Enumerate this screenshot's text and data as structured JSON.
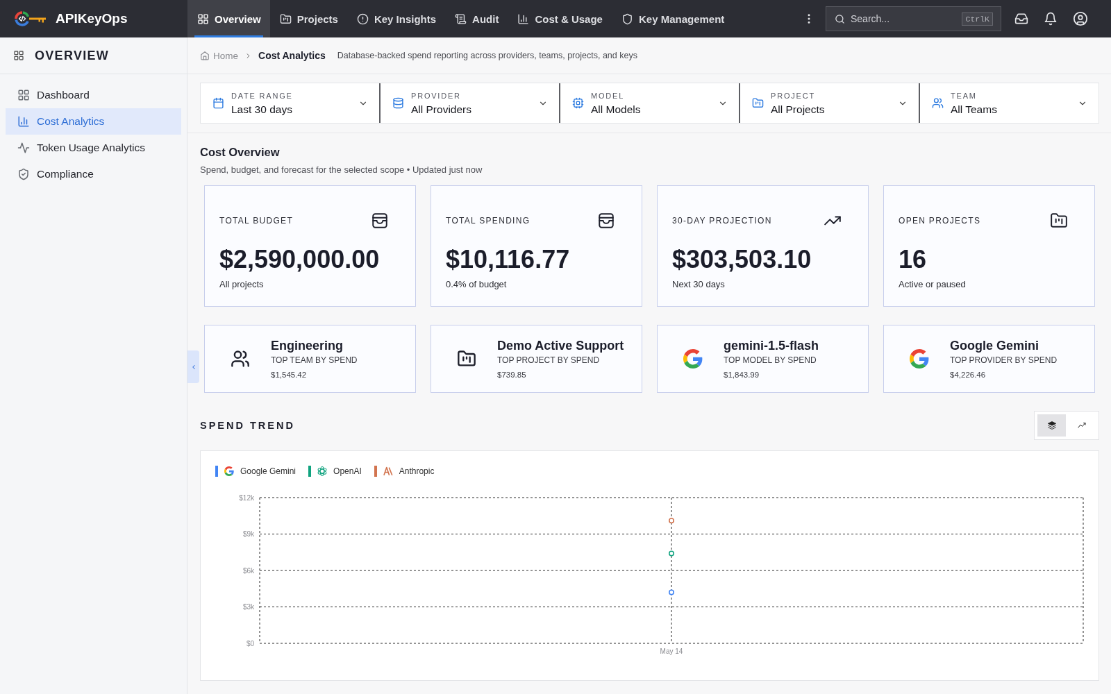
{
  "app": {
    "name": "APIKeyOps"
  },
  "nav": {
    "tabs": [
      {
        "label": "Overview",
        "kind": "overview",
        "selected": true
      },
      {
        "label": "Projects",
        "kind": "projects",
        "selected": false
      },
      {
        "label": "Key Insights",
        "kind": "insights",
        "selected": false
      },
      {
        "label": "Audit",
        "kind": "audit",
        "selected": false
      },
      {
        "label": "Cost & Usage",
        "kind": "cost",
        "selected": false
      },
      {
        "label": "Key Management",
        "kind": "keys",
        "selected": false
      }
    ],
    "search": {
      "placeholder": "Search...",
      "shortcut": "CtrlK"
    }
  },
  "sidebar": {
    "title": "OVERVIEW",
    "items": [
      {
        "label": "Dashboard",
        "kind": "dashboard",
        "selected": false
      },
      {
        "label": "Cost Analytics",
        "kind": "cost",
        "selected": true
      },
      {
        "label": "Token Usage Analytics",
        "kind": "tokens",
        "selected": false
      },
      {
        "label": "Compliance",
        "kind": "compliance",
        "selected": false
      }
    ]
  },
  "breadcrumb": {
    "items": [
      {
        "label": "Home",
        "current": false
      },
      {
        "label": "Cost Analytics",
        "current": true
      }
    ],
    "description": "Database-backed spend reporting across providers, teams, projects, and keys"
  },
  "filters": [
    {
      "kind": "date",
      "label": "DATE RANGE",
      "value": "Last 30 days"
    },
    {
      "kind": "provider",
      "label": "PROVIDER",
      "value": "All Providers"
    },
    {
      "kind": "model",
      "label": "MODEL",
      "value": "All Models"
    },
    {
      "kind": "project",
      "label": "PROJECT",
      "value": "All Projects"
    },
    {
      "kind": "team",
      "label": "TEAM",
      "value": "All Teams"
    }
  ],
  "cost_overview": {
    "title": "Cost Overview",
    "subtitle": "Spend, budget, and forecast for the selected scope • Updated just now",
    "stat_cards": [
      {
        "kind": "budget",
        "label": "TOTAL BUDGET",
        "value": "$2,590,000.00",
        "note": "All projects"
      },
      {
        "kind": "spending",
        "label": "TOTAL SPENDING",
        "value": "$10,116.77",
        "note": "0.4% of budget"
      },
      {
        "kind": "projection",
        "label": "30-DAY PROJECTION",
        "value": "$303,503.10",
        "note": "Next 30 days"
      },
      {
        "kind": "projects",
        "label": "OPEN PROJECTS",
        "value": "16",
        "note": "Active or paused"
      }
    ],
    "top_cards": [
      {
        "kind": "team",
        "title": "Engineering",
        "label": "TOP TEAM BY SPEND",
        "amount": "$1,545.42"
      },
      {
        "kind": "project",
        "title": "Demo Active Support",
        "label": "TOP PROJECT BY SPEND",
        "amount": "$739.85"
      },
      {
        "kind": "google",
        "title": "gemini-1.5-flash",
        "label": "TOP MODEL BY SPEND",
        "amount": "$1,843.99"
      },
      {
        "kind": "google",
        "title": "Google Gemini",
        "label": "TOP PROVIDER BY SPEND",
        "amount": "$4,226.46"
      }
    ]
  },
  "spend_trend": {
    "title": "SPEND TREND",
    "view_toggle": [
      {
        "kind": "stacked",
        "selected": true
      },
      {
        "kind": "line",
        "selected": false
      }
    ],
    "legend_logos": [
      {
        "kind": "google"
      },
      {
        "kind": "openai"
      },
      {
        "kind": "anthropic"
      }
    ],
    "chart_data": {
      "type": "line",
      "grid": true,
      "legend": "top-left",
      "categories": [
        "May 14"
      ],
      "series": [
        {
          "name": "Google Gemini",
          "color": "#4285f4",
          "marker": "circle",
          "values": [
            4200
          ]
        },
        {
          "name": "OpenAI",
          "color": "#10a37f",
          "marker": "circle",
          "values": [
            7400
          ]
        },
        {
          "name": "Anthropic",
          "color": "#d2744f",
          "marker": "circle",
          "values": [
            10100
          ]
        }
      ],
      "ylim": [
        0,
        12000
      ],
      "yticks": [
        {
          "value": 0,
          "label": "$0"
        },
        {
          "value": 3000,
          "label": "$3k"
        },
        {
          "value": 6000,
          "label": "$6k"
        },
        {
          "value": 9000,
          "label": "$9k"
        },
        {
          "value": 12000,
          "label": "$12k"
        }
      ]
    }
  }
}
